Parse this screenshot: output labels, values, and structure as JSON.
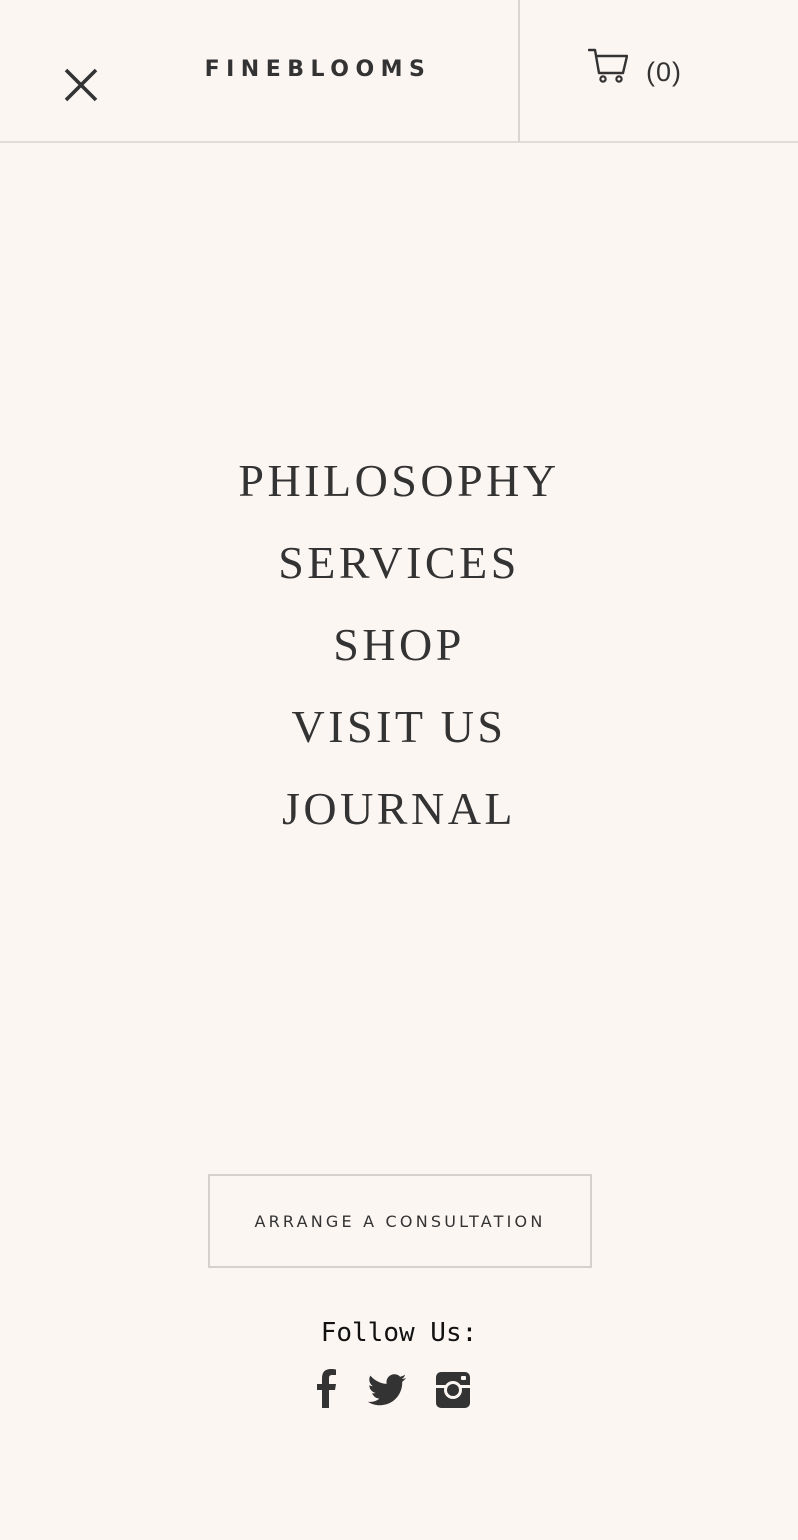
{
  "header": {
    "brand": "FINEBLOOMS",
    "close_icon": "close-icon",
    "cart_icon": "cart-icon",
    "cart_count": "(0)"
  },
  "nav": {
    "items": [
      {
        "label": "PHILOSOPHY"
      },
      {
        "label": "SERVICES"
      },
      {
        "label": "SHOP"
      },
      {
        "label": "VISIT US"
      },
      {
        "label": "JOURNAL"
      }
    ]
  },
  "cta": {
    "label": "ARRANGE A CONSULTATION"
  },
  "social": {
    "heading": "Follow Us:",
    "icons": [
      "facebook-icon",
      "twitter-icon",
      "instagram-icon"
    ]
  },
  "colors": {
    "background": "#fcf6f3",
    "text": "#333333",
    "border": "#d4d1cf"
  }
}
